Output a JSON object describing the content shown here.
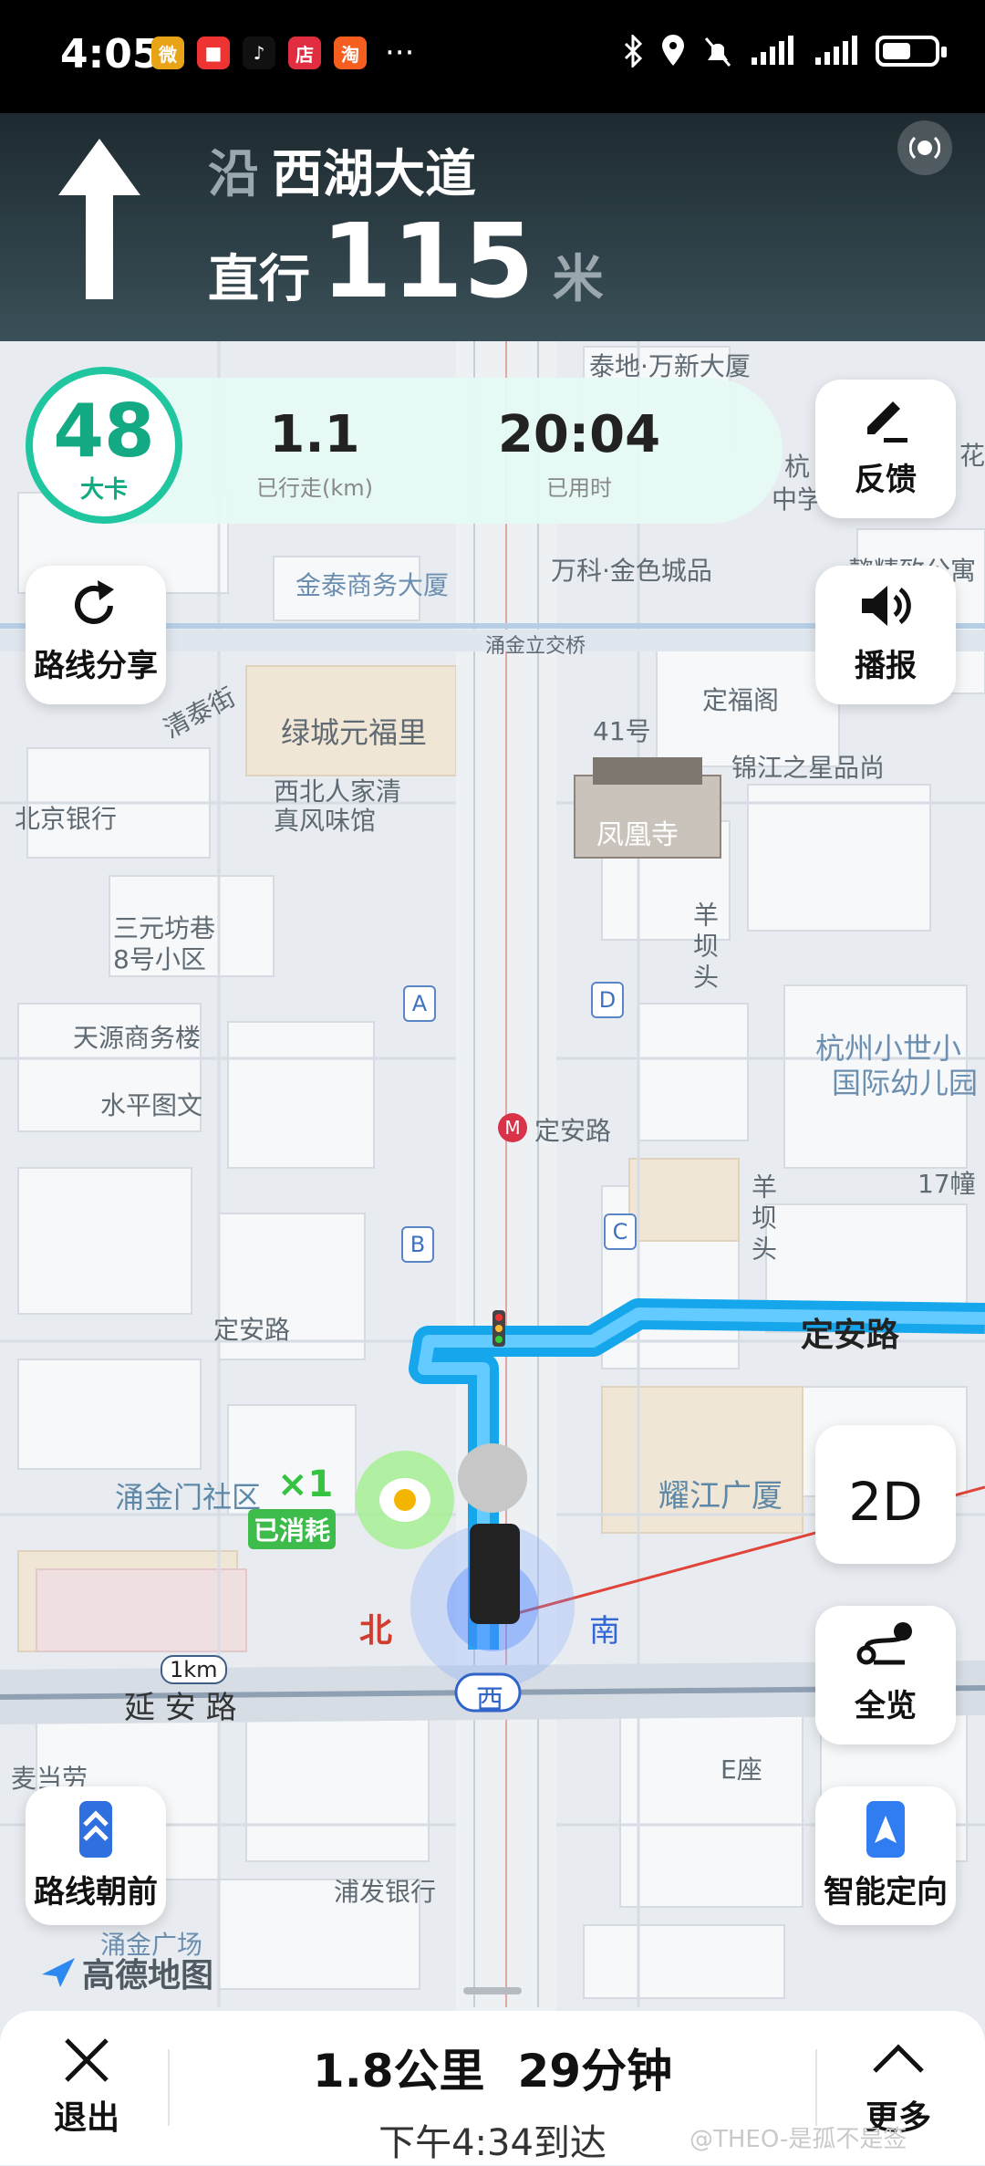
{
  "status_bar": {
    "time": "4:05",
    "apps": [
      "微",
      "■",
      "♪",
      "店",
      "淘"
    ],
    "more": "···"
  },
  "navigation": {
    "road_prefix": "沿",
    "road_name": "西湖大道",
    "action": "直行",
    "distance": "115",
    "unit": "米"
  },
  "stats": {
    "speed_limit": "48",
    "speed_label": "大卡",
    "traveled_value": "1.1",
    "traveled_label": "已行走(km)",
    "elapsed_value": "20:04",
    "elapsed_label": "已用时"
  },
  "buttons": {
    "feedback": "反馈",
    "broadcast": "播报",
    "share_route": "路线分享",
    "view_2d": "2D",
    "overview": "全览",
    "route_up": "路线朝前",
    "smart_orient": "智能定向"
  },
  "map_labels": {
    "taidi": "泰地·万新大厦",
    "jintai": "金泰商务大厦",
    "vanke": "万科·金色城品",
    "yongjin_bridge": "涌金立交桥",
    "dingfu": "定福阁",
    "lvcheng": "绿城元福里",
    "qingtai": "清泰街",
    "no41": "41号",
    "jinjiang": "锦江之星品尚",
    "northwest_1": "西北人家清",
    "northwest_2": "真风味馆",
    "fenghuang": "凤凰寺",
    "bj_bank": "北京银行",
    "sanyuan_1": "三元坊巷",
    "sanyuan_2": "8号小区",
    "yangba": "羊坝头",
    "tianyuan": "天源商务楼",
    "hz_kinder_1": "杭州小世小",
    "hz_kinder_2": "国际幼儿园",
    "shuiping": "水平图文",
    "dingan_metro": "定安路",
    "bldg17": "17幢",
    "yangba2": "羊坝头",
    "dingan_left": "定安路",
    "dingan_route": "定安路",
    "yongjinmen": "涌金门社区",
    "yaojiang": "耀江广厦",
    "yanan": "延 安 路",
    "scale": "1km",
    "mcd": "麦当劳",
    "e_block": "E座",
    "spd_bank": "浦发银行",
    "yongjin_sq": "涌金广场",
    "north": "北",
    "south": "南",
    "west": "西",
    "hangzhou": "杭",
    "middle": "中学",
    "flower": "花",
    "yijing": "懿精致公寓"
  },
  "entrances": [
    "A",
    "B",
    "C",
    "D"
  ],
  "badge": {
    "count": "×1",
    "status": "已消耗"
  },
  "brand": "高德地图",
  "bottom": {
    "exit": "退出",
    "distance": "1.8公里",
    "duration": "29分钟",
    "arrival": "下午4:34到达",
    "more": "更多"
  },
  "watermark": "@THEO-是孤不是签"
}
